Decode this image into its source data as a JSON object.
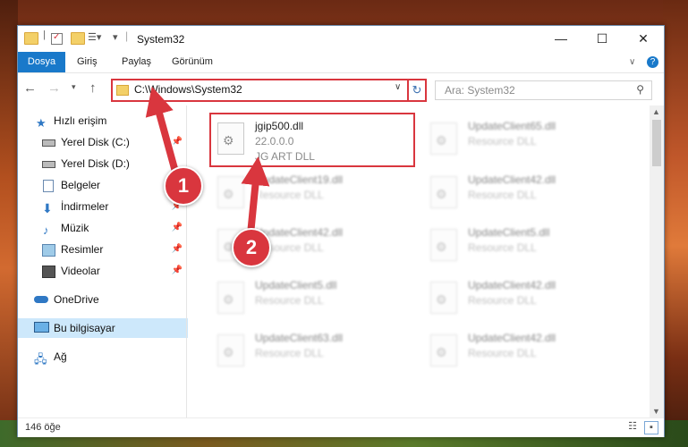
{
  "window": {
    "title": "System32",
    "ribbon_tabs": [
      "Dosya",
      "Giriş",
      "Paylaş",
      "Görünüm"
    ]
  },
  "address": {
    "path": "C:\\Windows\\System32",
    "search_placeholder": "Ara: System32"
  },
  "sidebar": {
    "items": [
      {
        "label": "Hızlı erişim",
        "icon": "star-icon",
        "pinned": false
      },
      {
        "label": "Yerel Disk (C:)",
        "icon": "drive-icon",
        "pinned": true
      },
      {
        "label": "Yerel Disk (D:)",
        "icon": "drive-icon",
        "pinned": false
      },
      {
        "label": "Belgeler",
        "icon": "document-icon",
        "pinned": false
      },
      {
        "label": "İndirmeler",
        "icon": "download-icon",
        "pinned": true
      },
      {
        "label": "Müzik",
        "icon": "music-icon",
        "pinned": true
      },
      {
        "label": "Resimler",
        "icon": "picture-icon",
        "pinned": true
      },
      {
        "label": "Videolar",
        "icon": "video-icon",
        "pinned": true
      },
      {
        "label": "OneDrive",
        "icon": "cloud-icon",
        "pinned": false
      },
      {
        "label": "Bu bilgisayar",
        "icon": "computer-icon",
        "pinned": false,
        "selected": true
      },
      {
        "label": "Ağ",
        "icon": "network-icon",
        "pinned": false
      }
    ]
  },
  "files": [
    {
      "name": "jgip500.dll",
      "line2": "22.0.0.0",
      "line3": "JG ART DLL"
    },
    {
      "name": "UpdateClient65.dll",
      "line2": "Resource DLL"
    },
    {
      "name": "UpdateClient19.dll",
      "line2": "Resource DLL"
    },
    {
      "name": "UpdateClient42.dll",
      "line2": "Resource DLL"
    },
    {
      "name": "UpdateClient42.dll",
      "line2": "Resource DLL"
    },
    {
      "name": "UpdateClient5.dll",
      "line2": "Resource DLL"
    },
    {
      "name": "UpdateClient5.dll",
      "line2": "Resource DLL"
    },
    {
      "name": "UpdateClient42.dll",
      "line2": "Resource DLL"
    },
    {
      "name": "UpdateClient63.dll",
      "line2": "Resource DLL"
    },
    {
      "name": "UpdateClient42.dll",
      "line2": "Resource DLL"
    }
  ],
  "status": {
    "item_count": "146 öğe"
  },
  "callouts": {
    "one": "1",
    "two": "2"
  },
  "colors": {
    "accent": "#1979ca",
    "callout": "#d9363e",
    "selected": "#cde8fb"
  }
}
